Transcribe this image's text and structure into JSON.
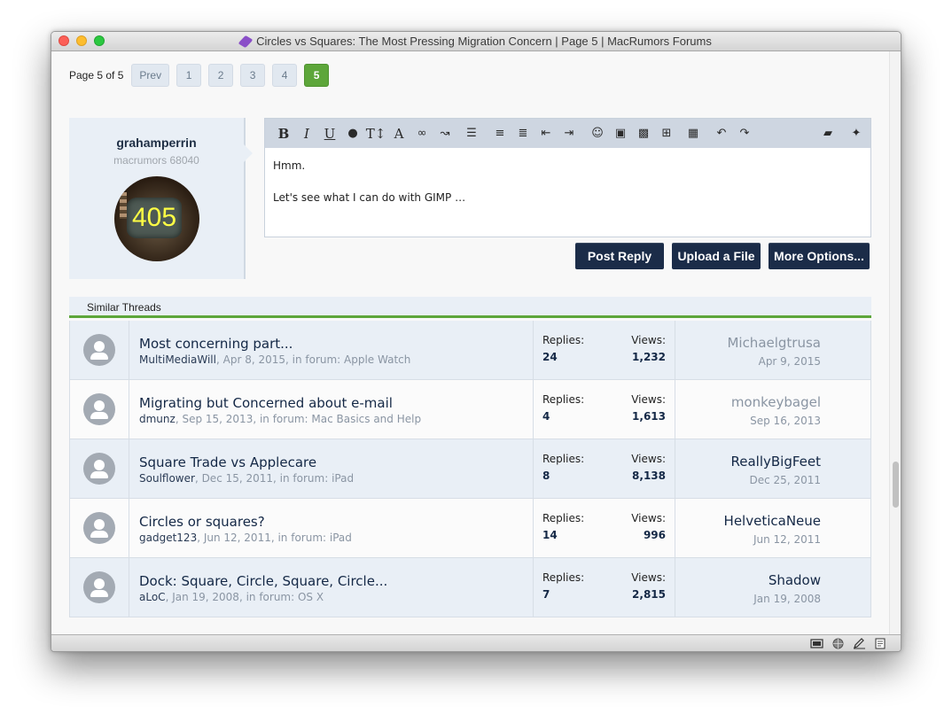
{
  "window": {
    "title": "Circles vs Squares: The Most Pressing Migration Concern | Page 5 | MacRumors Forums"
  },
  "pager": {
    "label": "Page 5 of 5",
    "prev": "Prev",
    "pages": [
      "1",
      "2",
      "3",
      "4",
      "5"
    ],
    "current": "5"
  },
  "user": {
    "name": "grahamperrin",
    "title": "macrumors 68040",
    "avatar_text": "405"
  },
  "editor": {
    "toolbar": [
      "bold",
      "italic",
      "underline",
      "color",
      "font-size",
      "font",
      "link",
      "unlink",
      "align",
      "bulleted-list",
      "numbered-list",
      "outdent",
      "indent",
      "smilie",
      "image",
      "media",
      "insert",
      "save",
      "undo",
      "redo",
      "remove-format",
      "settings"
    ],
    "lines": [
      "Hmm.",
      "Let's see what I can do with GIMP …"
    ]
  },
  "actions": {
    "post_reply": "Post Reply",
    "upload": "Upload a File",
    "more": "More Options..."
  },
  "similar": {
    "heading": "Similar Threads",
    "threads": [
      {
        "title": "Most concerning part...",
        "author": "MultiMediaWill",
        "meta": ", Apr 8, 2015, in forum: Apple Watch",
        "replies_label": "Replies:",
        "replies": "24",
        "views_label": "Views:",
        "views": "1,232",
        "last_user": "Michaelgtrusa",
        "last_date": "Apr 9, 2015"
      },
      {
        "title": "Migrating but Concerned about e-mail",
        "author": "dmunz",
        "meta": ", Sep 15, 2013, in forum: Mac Basics and Help",
        "replies_label": "Replies:",
        "replies": "4",
        "views_label": "Views:",
        "views": "1,613",
        "last_user": "monkeybagel",
        "last_date": "Sep 16, 2013"
      },
      {
        "title": "Square Trade vs Applecare",
        "author": "Soulflower",
        "meta": ", Dec 15, 2011, in forum: iPad",
        "replies_label": "Replies:",
        "replies": "8",
        "views_label": "Views:",
        "views": "8,138",
        "last_user": "ReallyBigFeet",
        "last_date": "Dec 25, 2011"
      },
      {
        "title": "Circles or squares?",
        "author": "gadget123",
        "meta": ", Jun 12, 2011, in forum: iPad",
        "replies_label": "Replies:",
        "replies": "14",
        "views_label": "Views:",
        "views": "996",
        "last_user": "HelveticaNeue",
        "last_date": "Jun 12, 2011"
      },
      {
        "title": "Dock: Square, Circle, Square, Circle...",
        "author": "aLoC",
        "meta": ", Jan 19, 2008, in forum: OS X",
        "replies_label": "Replies:",
        "replies": "7",
        "views_label": "Views:",
        "views": "2,815",
        "last_user": "Shadow",
        "last_date": "Jan 19, 2008"
      }
    ]
  },
  "colors": {
    "accent": "#5da63a",
    "navy": "#1b2c48",
    "panel": "#e9eff6"
  }
}
